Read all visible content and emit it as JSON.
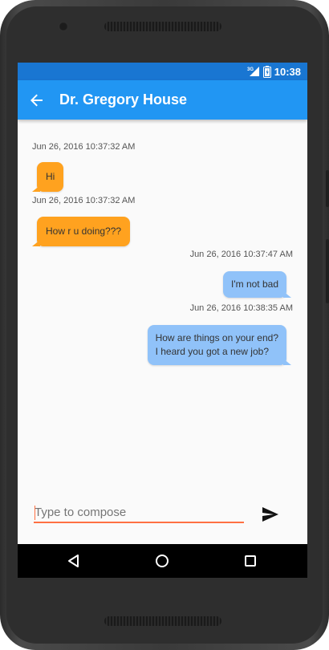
{
  "status_bar": {
    "network_label": "3G",
    "time": "10:38"
  },
  "app_bar": {
    "title": "Dr. Gregory House",
    "back_icon": "arrow-back-icon"
  },
  "messages": [
    {
      "timestamp": "Jun 26, 2016 10:37:32 AM",
      "text": "Hi",
      "direction": "incoming"
    },
    {
      "timestamp": "Jun 26, 2016 10:37:32 AM",
      "text": "How r u doing???",
      "direction": "incoming"
    },
    {
      "timestamp": "Jun 26, 2016 10:37:47 AM",
      "text": "I'm not bad",
      "direction": "outgoing"
    },
    {
      "timestamp": "Jun 26, 2016 10:38:35 AM",
      "text": "How are things on your end?\nI heard you got a new job?",
      "direction": "outgoing",
      "lines": [
        "How are things on your end?",
        "I heard you got a new job?"
      ]
    }
  ],
  "composer": {
    "placeholder": "Type to compose",
    "value": "",
    "send_icon": "send-icon"
  },
  "nav_bar": {
    "back_icon": "nav-back-icon",
    "home_icon": "nav-home-icon",
    "recents_icon": "nav-recents-icon"
  },
  "colors": {
    "status_bar": "#1976d2",
    "app_bar": "#2196f3",
    "incoming_bubble": "#ffa21f",
    "outgoing_bubble": "#90c2f9",
    "input_underline": "#ff7043"
  }
}
